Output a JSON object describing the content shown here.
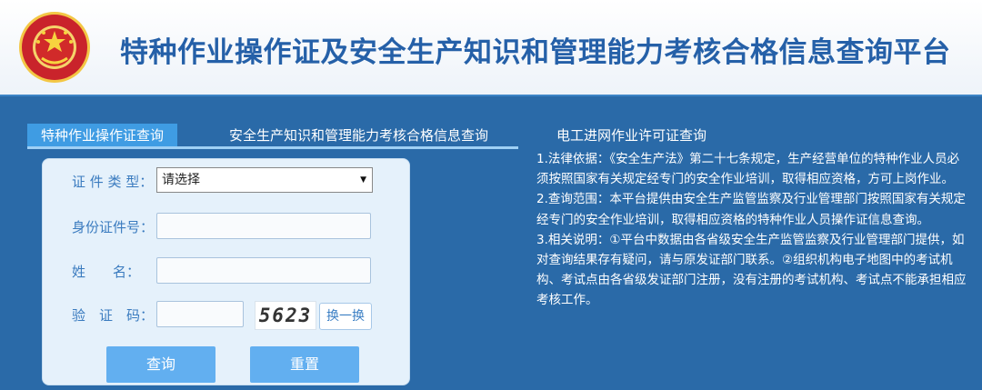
{
  "header": {
    "title": "特种作业操作证及安全生产知识和管理能力考核合格信息查询平台",
    "emblem_alt": "国家安全生产监督管理总局 STATE ADMINISTRATION OF WORK SAFETY"
  },
  "tabs": [
    {
      "label": "特种作业操作证查询",
      "active": true
    },
    {
      "label": "安全生产知识和管理能力考核合格信息查询",
      "active": false
    },
    {
      "label": "电工进网作业许可证查询",
      "active": false
    }
  ],
  "form": {
    "cert_type_label": "证 件 类 型：",
    "cert_type_value": "请选择",
    "id_label": "身份证件号：",
    "id_value": "",
    "name_label": "姓　　名：",
    "name_value": "",
    "captcha_label": "验　证　码：",
    "captcha_value": "",
    "captcha_text": "5623",
    "refresh_label": "换一换",
    "query_label": "查询",
    "reset_label": "重置"
  },
  "notes": [
    "1.法律依据：《安全生产法》第二十七条规定，生产经营单位的特种作业人员必须按照国家有关规定经专门的安全作业培训，取得相应资格，方可上岗作业。",
    "2.查询范围：本平台提供由安全生产监管监察及行业管理部门按照国家有关规定经专门的安全作业培训，取得相应资格的特种作业人员操作证信息查询。",
    "3.相关说明：①平台中数据由各省级安全生产监管监察及行业管理部门提供，如对查询结果存有疑问，请与原发证部门联系。②组织机构电子地图中的考试机构、考试点由各省级发证部门注册，没有注册的考试机构、考试点不能承担相应考核工作。"
  ],
  "colors": {
    "brand": "#2560a8",
    "background": "#2a6aa8",
    "tab_active": "#3f9ce3",
    "button": "#62aff0"
  }
}
